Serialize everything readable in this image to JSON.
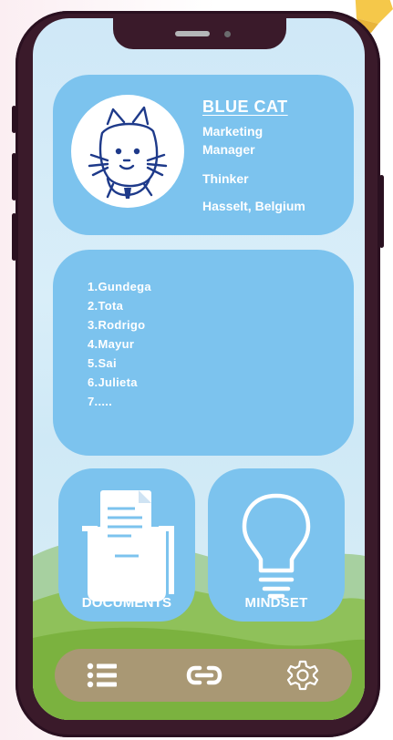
{
  "profile": {
    "name": "BLUE CAT",
    "lines": [
      "Marketing",
      "Manager",
      "Thinker",
      "Hasselt, Belgium"
    ]
  },
  "team_list": [
    "1.Gundega",
    "2.Tota",
    "3.Rodrigo",
    "4.Mayur",
    "5.Sai",
    "6.Julieta",
    "7....."
  ],
  "tiles": {
    "documents_label": "DOCUMENTS",
    "mindset_label": "MINDSET"
  },
  "navbar": {
    "icons": [
      "list-icon",
      "link-icon",
      "gear-icon"
    ]
  },
  "colors": {
    "card": "#7cc3ee",
    "phone_frame": "#3a1a2a",
    "navbar": "#a99874",
    "hills": "#7bb23f"
  }
}
